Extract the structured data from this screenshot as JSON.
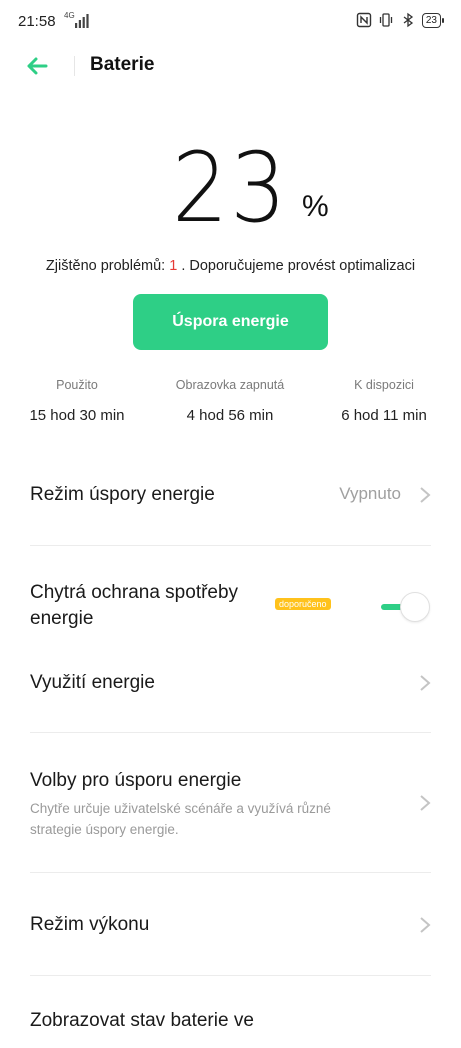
{
  "status_bar": {
    "time": "21:58",
    "network": "4G",
    "battery_level": "23"
  },
  "header": {
    "title": "Baterie"
  },
  "battery": {
    "percent": "23",
    "unit": "%"
  },
  "problems": {
    "prefix": "Zjištěno problémů: ",
    "count": "1",
    "suffix": " . Doporučujeme provést optimalizaci"
  },
  "save_button": "Úspora energie",
  "stats": [
    {
      "label": "Použito",
      "value": "15 hod 30 min"
    },
    {
      "label": "Obrazovka zapnutá",
      "value": "4 hod 56 min"
    },
    {
      "label": "K dispozici",
      "value": "6 hod 11 min"
    }
  ],
  "settings": {
    "power_saving_mode": {
      "title": "Režim úspory energie",
      "value": "Vypnuto"
    },
    "smart_protection": {
      "title": "Chytrá ochrana spotřeby energie",
      "badge": "doporučeno",
      "enabled": true
    },
    "energy_usage": {
      "title": "Využití energie"
    },
    "saving_options": {
      "title": "Volby pro úsporu energie",
      "subtitle": "Chytře určuje uživatelské scénáře a využívá různé strategie úspory energie."
    },
    "performance_mode": {
      "title": "Režim výkonu"
    },
    "show_status": {
      "title": "Zobrazovat stav baterie ve"
    }
  },
  "colors": {
    "accent": "#2ecf86",
    "badge": "#ffc21c",
    "alert": "#e53935"
  },
  "icons": [
    "back-arrow-icon",
    "chevron-right-icon",
    "nfc-icon",
    "vibrate-icon",
    "bluetooth-icon",
    "battery-icon",
    "signal-icon"
  ]
}
